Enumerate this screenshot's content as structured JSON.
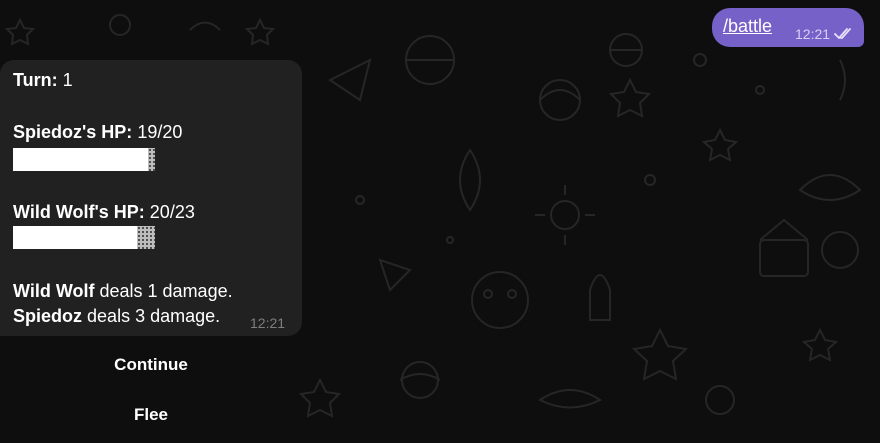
{
  "outgoing": {
    "text": "/battle",
    "time": "12:21"
  },
  "incoming": {
    "turn_label": "Turn:",
    "turn_value": "1",
    "player": {
      "hp_label": "Spiedoz's HP:",
      "hp_value": "19/20",
      "hp_fraction": 0.95
    },
    "enemy": {
      "hp_label": "Wild Wolf's HP:",
      "hp_value": "20/23",
      "hp_fraction": 0.87
    },
    "log": [
      {
        "actor": "Wild Wolf",
        "text": "deals 1 damage."
      },
      {
        "actor": "Spiedoz",
        "text": "deals 3 damage."
      }
    ],
    "time": "12:21"
  },
  "keyboard": {
    "continue_label": "Continue",
    "flee_label": "Flee"
  },
  "colors": {
    "outgoing_bubble": "#7661c8",
    "incoming_bubble": "#212121",
    "background": "#0e0e0e"
  },
  "icons": {
    "read_receipt": "double-check-icon"
  }
}
